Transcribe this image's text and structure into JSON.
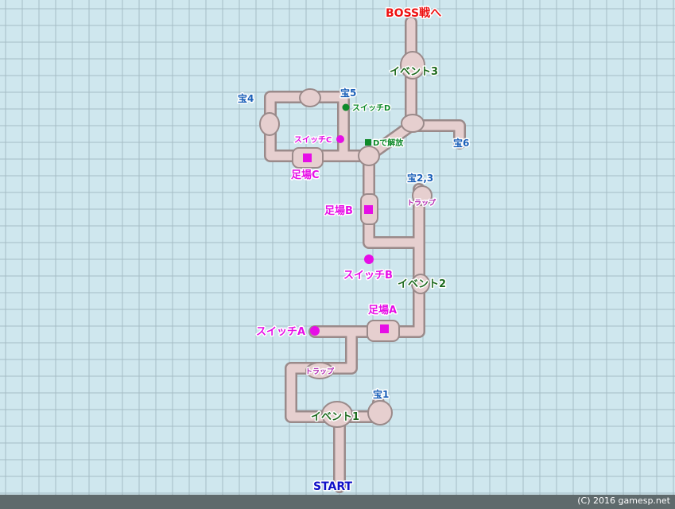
{
  "colors": {
    "background": "#cfe7ee",
    "grid": "#a6bcc5",
    "path_fill": "#e6cfcf",
    "path_stroke": "#9a8a8a",
    "boss": "#ee1111",
    "event": "#1f6b1f",
    "treasure": "#1a5fb8",
    "platform": "#e60ee6",
    "trap": "#b020b0",
    "switch_d": "#0f8a2a",
    "start": "#1010c8"
  },
  "labels": {
    "boss": "BOSS戦へ",
    "event3": "イベント3",
    "event2": "イベント2",
    "event1": "イベント1",
    "treasure4": "宝4",
    "treasure5": "宝5",
    "treasure6": "宝6",
    "treasure23": "宝2,3",
    "treasure1": "宝1",
    "switch_d": "スイッチD",
    "switch_c": "スイッチC",
    "d_release": "Dで解放",
    "platform_c": "足場C",
    "platform_b": "足場B",
    "platform_a": "足場A",
    "trap_upper": "トラップ",
    "trap_lower": "トラップ",
    "switch_b": "スイッチB",
    "switch_a": "スイッチA",
    "start": "START"
  },
  "footer": {
    "credit": "(C) 2016 gamesp.net"
  }
}
